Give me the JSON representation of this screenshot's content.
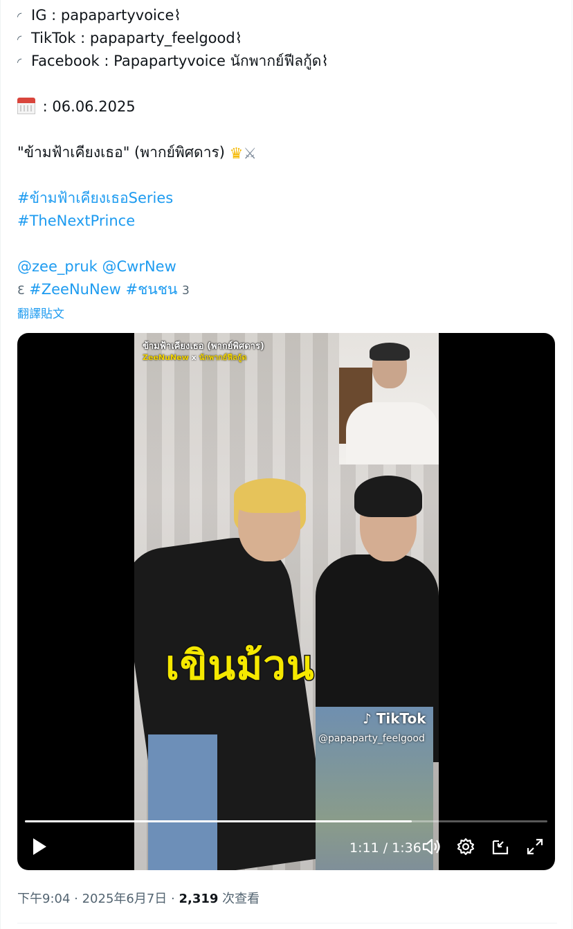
{
  "tweet": {
    "lines": {
      "ig": "IG : papapartyvoice",
      "tiktok": "TikTok : papaparty_feelgood",
      "facebook": "Facebook : Papapartyvoice นักพากย์ฟีลกู้ด",
      "bullet_glyph": "◜",
      "end_glyph": "⌇",
      "date": " : 06.06.2025",
      "title": "\"ข้ามฟ้าเคียงเธอ\" (พากย์พิศดาร)",
      "hashtag_series": "#ข้ามฟ้าเคียงเธอSeries",
      "hashtag_prince": "#TheNextPrince",
      "mention_zee": "@zee_pruk",
      "mention_cwr": "@CwrNew",
      "open_bracket": "Ɛ",
      "hashtag_zeenunew": "#ZeeNuNew",
      "hashtag_chonchon": "#ชนชน",
      "close_bracket": "3"
    },
    "translate_label": "翻譯貼文"
  },
  "video": {
    "overlay_title": "ข้ามฟ้าเคียงเธอ (พากย์พิศดาร)",
    "overlay_sub_a": "ZeeNuNew",
    "overlay_sub_x": " x ",
    "overlay_sub_b": "นักพากย์ฟีลกู้ด",
    "caption": "เขินม้วน",
    "tiktok_mark": "TikTok",
    "tiktok_handle": "@papaparty_feelgood",
    "time": "1:11 / 1:36",
    "progress_fraction": 0.74
  },
  "meta": {
    "time": "下午9:04",
    "sep1": " · ",
    "date": "2025年6月7日",
    "sep2": " · ",
    "views_count": "2,319",
    "views_label": " 次查看"
  },
  "colors": {
    "link": "#1d9bf0",
    "muted": "#536471",
    "text": "#0f1419"
  },
  "icons": [
    "calendar-icon",
    "crown-icon",
    "crossed-swords-icon",
    "play-icon",
    "volume-icon",
    "settings-icon",
    "pip-icon",
    "fullscreen-icon"
  ]
}
